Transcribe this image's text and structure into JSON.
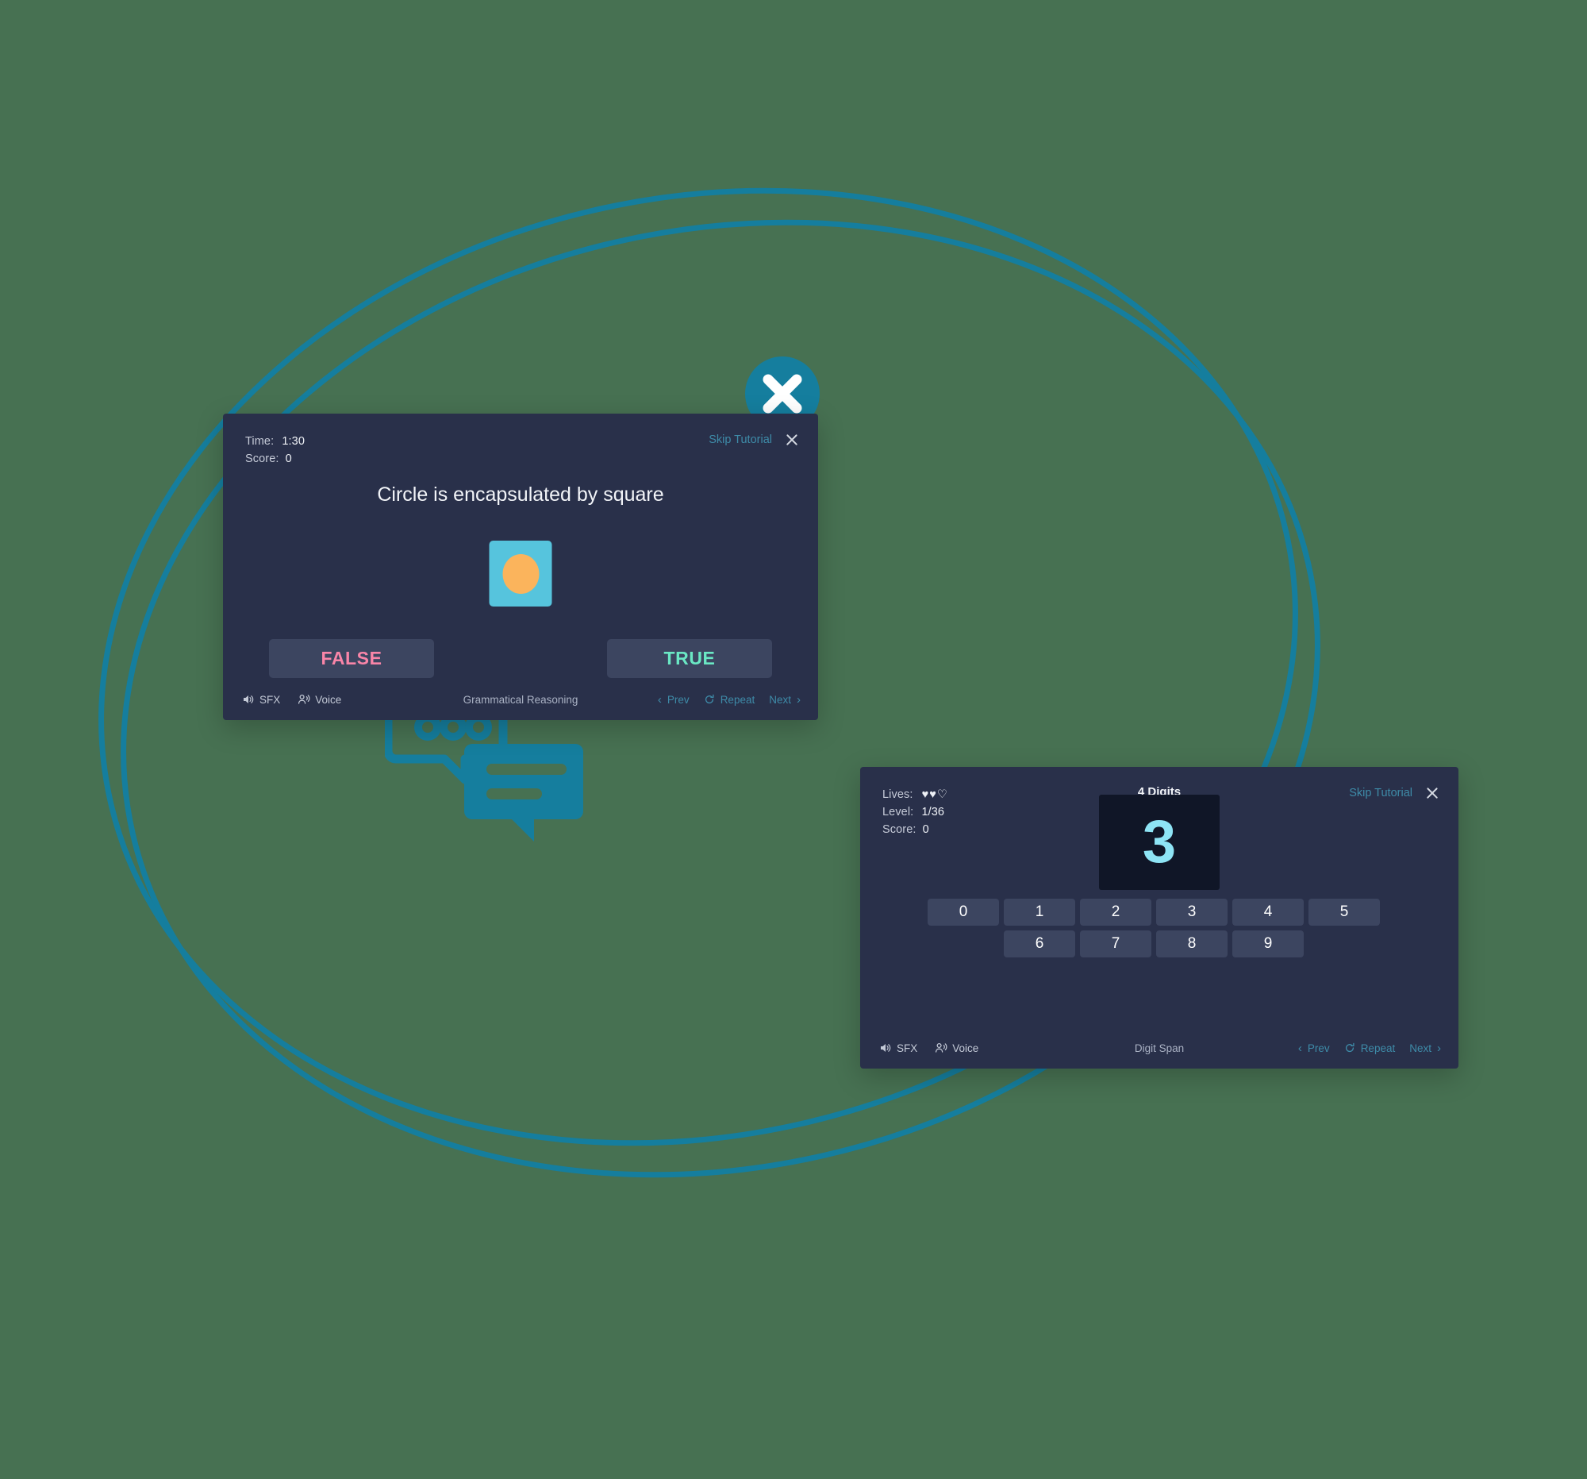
{
  "theme": {
    "page_background": "#477152",
    "panel_background": "#29304a",
    "accent_teal": "#157e9e",
    "link_teal": "#3e8ba8",
    "button_slate": "#3c4560",
    "false_pink": "#f985a8",
    "true_mint": "#6ae7c4",
    "digit_cyan": "#8ee4f5",
    "stimulus_square": "#56c4dd",
    "stimulus_circle": "#fbb45c",
    "digit_display_bg": "#101627"
  },
  "decorations": {
    "x_badge_icon": "circle-x-filled-icon",
    "check_badge_icon": "circle-check-outline-icon",
    "chat_icon": "chat-bubbles-icon",
    "ellipse_outline_icon": "ellipse-outline-decoration"
  },
  "grammar_panel": {
    "hud": {
      "time_label": "Time:",
      "time_value": "1:30",
      "score_label": "Score:",
      "score_value": "0"
    },
    "skip_label": "Skip Tutorial",
    "close_icon": "close-icon",
    "prompt": "Circle is encapsulated by square",
    "stimulus": {
      "outer_shape": "square",
      "inner_shape": "circle"
    },
    "buttons": {
      "false_label": "FALSE",
      "true_label": "TRUE"
    },
    "footer": {
      "sfx_label": "SFX",
      "voice_label": "Voice",
      "task_name": "Grammatical Reasoning",
      "prev_label": "Prev",
      "repeat_label": "Repeat",
      "next_label": "Next"
    }
  },
  "digit_panel": {
    "hud": {
      "lives_label": "Lives:",
      "lives_total": 3,
      "lives_remaining": 2,
      "lives_glyphs": "♥♥♡",
      "level_label": "Level:",
      "level_value": "1/36",
      "score_label": "Score:",
      "score_value": "0"
    },
    "title": "4 Digits",
    "skip_label": "Skip Tutorial",
    "close_icon": "close-icon",
    "current_digit": "3",
    "keypad": {
      "row1": [
        "0",
        "1",
        "2",
        "3",
        "4",
        "5"
      ],
      "row2": [
        "6",
        "7",
        "8",
        "9"
      ]
    },
    "footer": {
      "sfx_label": "SFX",
      "voice_label": "Voice",
      "task_name": "Digit Span",
      "prev_label": "Prev",
      "repeat_label": "Repeat",
      "next_label": "Next"
    }
  }
}
